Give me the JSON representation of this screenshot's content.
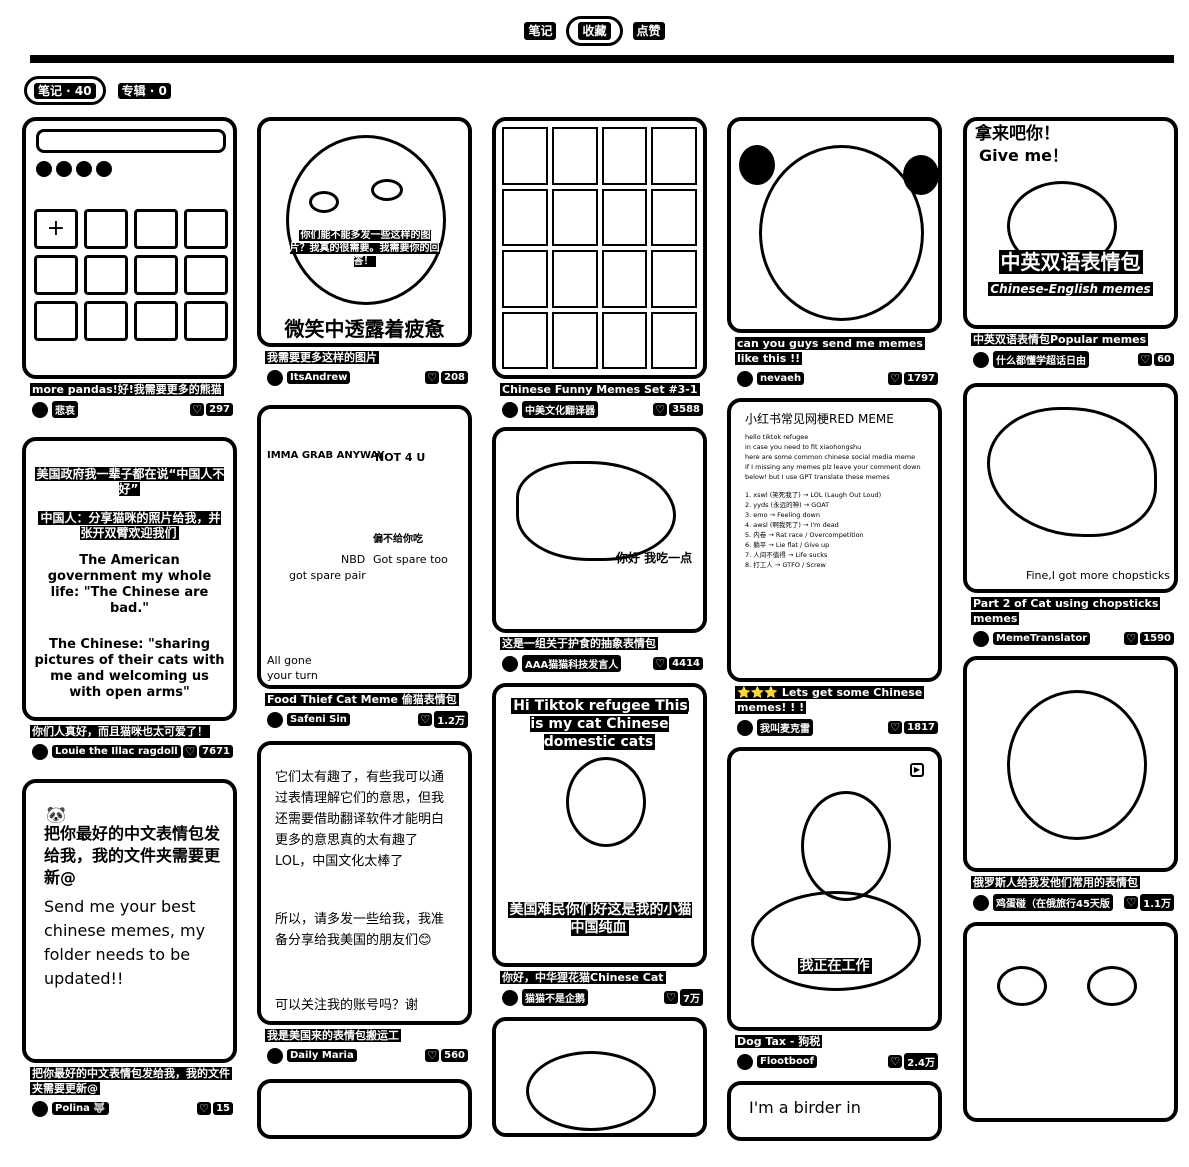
{
  "tabs": {
    "notes": "笔记",
    "collect": "收藏",
    "likes": "点赞"
  },
  "subtabs": {
    "notes": "笔记 · 40",
    "albums": "专辑 · 0"
  },
  "cards": {
    "c1": {
      "title": "more pandas!好!我需要更多的熊猫",
      "author": "悲哀",
      "likes": "297"
    },
    "c2": {
      "title": "你们人真好，而且猫咪也太可爱了！",
      "author": "Louie the Illac ragdoll",
      "likes": "7671",
      "ov1": "美国政府我一辈子都在说“中国人不好”",
      "ov2": "中国人：分享猫咪的照片给我，并张开双臂欢迎我们",
      "ov3": "The American government my whole life: \"The Chinese are bad.\"",
      "ov4": "The Chinese: \"sharing pictures of their cats with me and welcoming us with open arms\""
    },
    "c3": {
      "title": "把你最好的中文表情包发给我，我的文件夹需要更新@",
      "author": "Polina 🐺",
      "likes": "15",
      "ov1": "把你最好的中文表情包发给我，我的文件夹需要更新@",
      "ov2": "Send me your best chinese memes, my folder needs to be updated!!"
    },
    "c4": {
      "title": "我需要更多这样的图片",
      "author": "ItsAndrew",
      "likes": "208",
      "ov1": "你们能不能多发一些这样的图片？我真的很需要。我需要你的回答！",
      "ov2": "微笑中透露着疲惫"
    },
    "c5": {
      "title": "Food Thief Cat Meme 偷猫表情包",
      "author": "Safeni Sin",
      "likes": "1.2万",
      "ov1": "IMMA GRAB ANYWAY",
      "ov2": "NOT 4 U",
      "ov3": "偏不给你吃",
      "ov4": "NBD",
      "ov5": "Got spare too",
      "ov6": "got spare pair",
      "ov7": "All gone your turn"
    },
    "c6": {
      "title": "我是美国来的表情包搬运工",
      "author": "Daily Maria",
      "likes": "560",
      "ov1": "它们太有趣了，有些我可以通过表情理解它们的意思，但我还需要借助翻译软件才能明白更多的意思真的太有趣了LOL，中国文化太棒了",
      "ov2": "所以，请多发一些给我，我准备分享给我美国的朋友们😊",
      "ov3": "可以关注我的账号吗？谢"
    },
    "c7": {
      "title": "Chinese Funny Memes Set #3-1",
      "author": "中美文化翻译器",
      "likes": "3588"
    },
    "c8": {
      "title": "这是一组关于护食的抽象表情包",
      "author": "AAA猫猫科技发言人",
      "likes": "4414",
      "ov1": "你好 我吃一点"
    },
    "c9": {
      "title": "你好，中华狸花猫Chinese Cat",
      "author": "猫猫不是企鹅",
      "likes": "7万",
      "ov1": "Hi Tiktok refugee This is my cat Chinese domestic cats",
      "ov2": "美国难民你们好这是我的小猫中国纯血"
    },
    "c10": {
      "title": "can you guys send me memes like this !!",
      "author": "nevaeh",
      "likes": "1797"
    },
    "c11": {
      "title": "⭐⭐⭐ Lets get some Chinese memes! ! !",
      "author": "我叫麦克雷",
      "likes": "1817",
      "head": "小红书常见网梗RED MEME",
      "lines": [
        "hello tiktok refugee",
        "in case you need to fit xiaohongshu",
        "here are some common chinese social media meme",
        "if I missing any memes plz leave your comment down below! but I use GPT translate these memes",
        "1. xswl (笑死我了) → LOL (Laugh Out Loud)",
        "2. yyds (永远的神) → GOAT",
        "3. emo → Feeling down",
        "4. awsl (啊我死了) → I'm dead",
        "5. 内卷 → Rat race / Overcompetition",
        "6. 躺平 → Lie flat / Give up",
        "7. 人间不值得 → Life sucks",
        "8. 打工人 → GTFO / Screw"
      ]
    },
    "c12": {
      "title": "Dog Tax - 狗税",
      "author": "Flootboof",
      "likes": "2.4万",
      "ov1": "我正在工作"
    },
    "c13": {
      "title": "I'm a birder in",
      "ov1": "I'm a birder in"
    },
    "c14": {
      "title": "中英双语表情包Popular memes",
      "author": "什么都懂学超话日由",
      "likes": "60",
      "ov1": "拿来吧你！",
      "ov2": "Give me！",
      "ov3": "中英双语表情包",
      "ov4": "Chinese-English memes"
    },
    "c15": {
      "title": "Part 2 of Cat using chopsticks memes",
      "author": "MemeTranslator",
      "likes": "1590",
      "ov1": "Fine,I got more chopsticks"
    },
    "c16": {
      "title": "俄罗斯人给我发他们常用的表情包",
      "author": "鸡蛋碰（在俄旅行45天版",
      "likes": "1.1万"
    }
  }
}
